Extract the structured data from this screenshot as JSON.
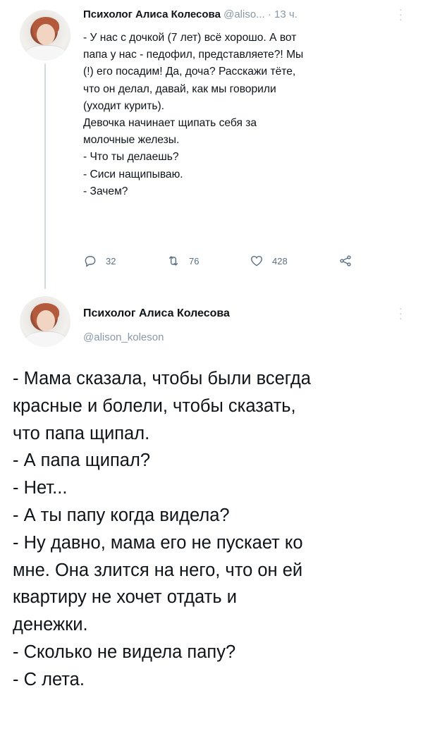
{
  "tweet1": {
    "author_name": "Психолог Алиса Колесова",
    "handle": "@aliso...",
    "time": "· 13 ч.",
    "lines": [
      "- У нас с дочкой (7 лет) всё хорошо. А вот",
      "папа у нас - педофил, представляете?! Мы",
      "(!) его посадим! Да, доча? Расскажи тёте,",
      "что он делал, давай, как мы говорили",
      "(уходит курить).",
      "Девочка начинает щипать себя за",
      "молочные железы.",
      "- Что ты делаешь?",
      "- Сиси нащипываю.",
      "- Зачем?"
    ],
    "replies": "32",
    "retweets": "76",
    "likes": "428",
    "icons": [
      "reply-icon",
      "retweet-icon",
      "like-icon",
      "share-icon"
    ]
  },
  "tweet2": {
    "author_name": "Психолог Алиса Колесова",
    "handle": "@alison_koleson",
    "lines": [
      "- Мама сказала, чтобы были всегда",
      "красные и болели, чтобы сказать,",
      "что папа щипал.",
      "- А папа щипал?",
      "- Нет...",
      "- А ты папу когда видела?",
      "- Ну давно, мама его не пускает ко",
      "мне. Она злится на него, что он ей",
      "квартиру не хочет отдать и",
      "денежки.",
      "- Сколько не видела папу?",
      "- С лета."
    ]
  },
  "colors": {
    "text": "#0f1419",
    "secondary": "#8899a6",
    "icon": "#5b7083",
    "thread_line": "#cfd9de"
  }
}
